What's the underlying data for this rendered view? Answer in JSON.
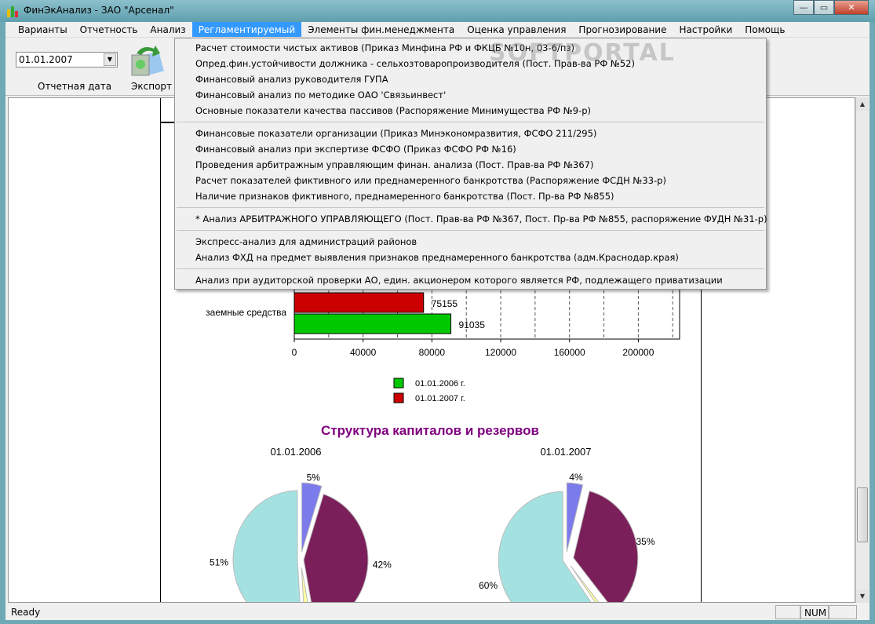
{
  "window": {
    "title": "ФинЭкАнализ - ЗАО \"Арсенал\"",
    "min": "—",
    "max": "▭",
    "close": "✕"
  },
  "menubar": [
    "Варианты",
    "Отчетность",
    "Анализ",
    "Регламентируемый",
    "Элементы фин.менеджмента",
    "Оценка управления",
    "Прогнозирование",
    "Настройки",
    "Помощь"
  ],
  "toolbar": {
    "date_value": "01.01.2007",
    "date_label": "Отчетная дата",
    "export_label": "Экспорт"
  },
  "dropdown": {
    "groups": [
      [
        "Расчет стоимости чистых активов (Приказ Минфина РФ и ФКЦБ №10н, 03-6/пз)",
        "Опред.фин.устойчивости должника - сельхозтоваропроизводителя (Пост. Прав-ва РФ №52)",
        "Финансовый анализ руководителя ГУПА",
        "Финансовый анализ по методике ОАО 'Связьинвест'",
        "Основные показатели качества пассивов (Распоряжение Минимущества РФ №9-р)"
      ],
      [
        "Финансовые показатели организации (Приказ Минэкономразвития, ФСФО 211/295)",
        "Финансовый анализ при экспертизе ФСФО (Приказ ФСФО РФ №16)",
        "Проведения арбитражным управляющим финан. анализа (Пост. Прав-ва РФ №367)",
        "Расчет показателей фиктивного или преднамеренного банкротства (Распоряжение ФСДН №33-р)",
        "Наличие признаков фиктивного, преднамеренного банкротства (Пост. Пр-ва РФ №855)"
      ],
      [
        "* Анализ АРБИТРАЖНОГО УПРАВЛЯЮЩЕГО (Пост. Прав-ва РФ №367, Пост. Пр-ва РФ №855, распоряжение ФУДН №31-р)"
      ],
      [
        "Экспресс-анализ для администраций районов",
        "Анализ ФХД на предмет выявления признаков преднамеренного банкротства (адм.Краснодар.края)"
      ],
      [
        "Анализ при аудиторской проверки АО, един. акционером которого является РФ, подлежащего приватизации"
      ]
    ]
  },
  "watermark": "SOFTPORTAL",
  "status": {
    "text": "Ready",
    "num": "NUM"
  },
  "chart_data": [
    {
      "type": "bar",
      "orientation": "horizontal",
      "categories": [
        "заемные средства"
      ],
      "series": [
        {
          "name": "01.01.2007 г.",
          "color": "#cc0000",
          "values": [
            75155
          ]
        },
        {
          "name": "01.01.2006 г.",
          "color": "#00c800",
          "values": [
            91035
          ]
        }
      ],
      "xticks": [
        0,
        40000,
        80000,
        120000,
        160000,
        200000
      ],
      "xlim": [
        0,
        224000
      ],
      "grid": true,
      "legend": "bottom",
      "legend_items": [
        {
          "label": "01.01.2006 г.",
          "color": "#00c800"
        },
        {
          "label": "01.01.2007 г.",
          "color": "#cc0000"
        }
      ]
    },
    {
      "type": "pie",
      "title": "Структура капиталов и резервов",
      "pies": [
        {
          "label": "01.01.2006",
          "slices": [
            {
              "value": 5,
              "label": "5%",
              "color": "#7b7bec"
            },
            {
              "value": 42,
              "label": "42%",
              "color": "#7b1f5a"
            },
            {
              "value": 2,
              "label": "",
              "color": "#ffffa0"
            },
            {
              "value": 51,
              "label": "51%",
              "color": "#a4e2e2"
            }
          ]
        },
        {
          "label": "01.01.2007",
          "slices": [
            {
              "value": 4,
              "label": "4%",
              "color": "#7b7bec"
            },
            {
              "value": 35,
              "label": "35%",
              "color": "#7b1f5a"
            },
            {
              "value": 1,
              "label": "",
              "color": "#ffffa0"
            },
            {
              "value": 60,
              "label": "60%",
              "color": "#a4e2e2"
            }
          ]
        }
      ]
    }
  ]
}
